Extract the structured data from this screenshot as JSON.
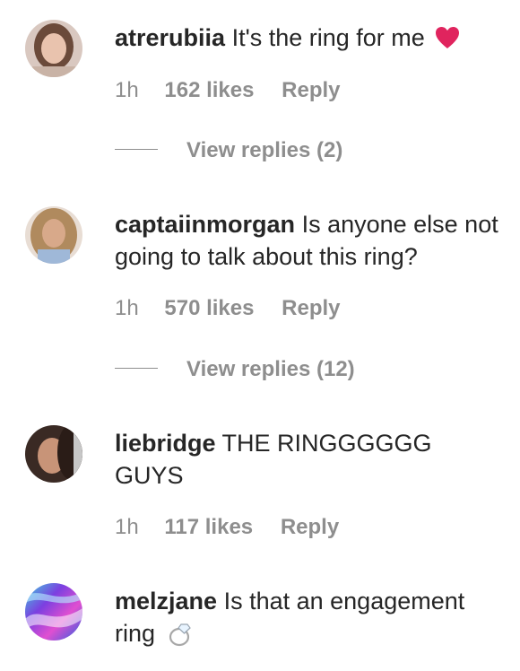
{
  "comments": [
    {
      "username": "atrerubiia",
      "text": "It's the ring for me",
      "emoji": "red-heart",
      "time": "1h",
      "likes": "162 likes",
      "reply": "Reply",
      "view_replies": "View replies (2)",
      "avatar_icon": "avatar-photo"
    },
    {
      "username": "captaiinmorgan",
      "text": "Is anyone else not going to talk about this ring?",
      "time": "1h",
      "likes": "570 likes",
      "reply": "Reply",
      "view_replies": "View replies (12)",
      "avatar_icon": "avatar-photo"
    },
    {
      "username": "liebridge",
      "text": "THE RINGGGGGG GUYS",
      "time": "1h",
      "likes": "117 likes",
      "reply": "Reply",
      "avatar_icon": "avatar-photo"
    },
    {
      "username": "melzjane",
      "text": "Is that an engagement ring",
      "emoji": "ring",
      "avatar_icon": "avatar-photo"
    }
  ],
  "colors": {
    "text": "#262626",
    "secondary": "#8e8e8e",
    "background": "#ffffff",
    "heart": "#e0245e"
  }
}
